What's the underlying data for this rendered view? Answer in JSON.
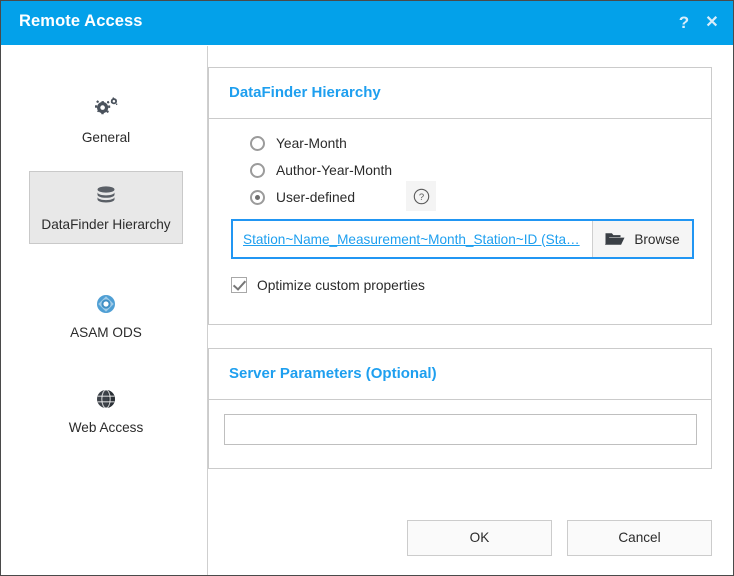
{
  "window": {
    "title": "Remote Access",
    "help_icon": "question-mark-icon",
    "close_icon": "close-icon",
    "accent_color": "#03A1EA",
    "heading_color": "#1E9FEF",
    "focus_color": "#2196F3"
  },
  "sidebar": {
    "items": [
      {
        "label": "General",
        "icon": "gears-icon",
        "selected": false
      },
      {
        "label": "DataFinder Hierarchy",
        "icon": "database-icon",
        "selected": true
      },
      {
        "label": "ASAM ODS",
        "icon": "asam-ods-icon",
        "selected": false
      },
      {
        "label": "Web Access",
        "icon": "globe-icon",
        "selected": false
      }
    ]
  },
  "main": {
    "hierarchy_group": {
      "title": "DataFinder Hierarchy",
      "options": [
        {
          "label": "Year-Month",
          "selected": false
        },
        {
          "label": "Author-Year-Month",
          "selected": false
        },
        {
          "label": "User-defined",
          "selected": true
        }
      ],
      "help_button": "help-icon",
      "path_value": "Station~Name_Measurement~Month_Station~ID (Sta…",
      "browse_label": "Browse",
      "browse_icon": "folder-open-icon",
      "checkbox": {
        "label": "Optimize custom properties",
        "checked": true
      }
    },
    "server_group": {
      "title": "Server Parameters (Optional)",
      "input_value": "",
      "input_placeholder": ""
    }
  },
  "footer": {
    "ok_label": "OK",
    "cancel_label": "Cancel"
  }
}
